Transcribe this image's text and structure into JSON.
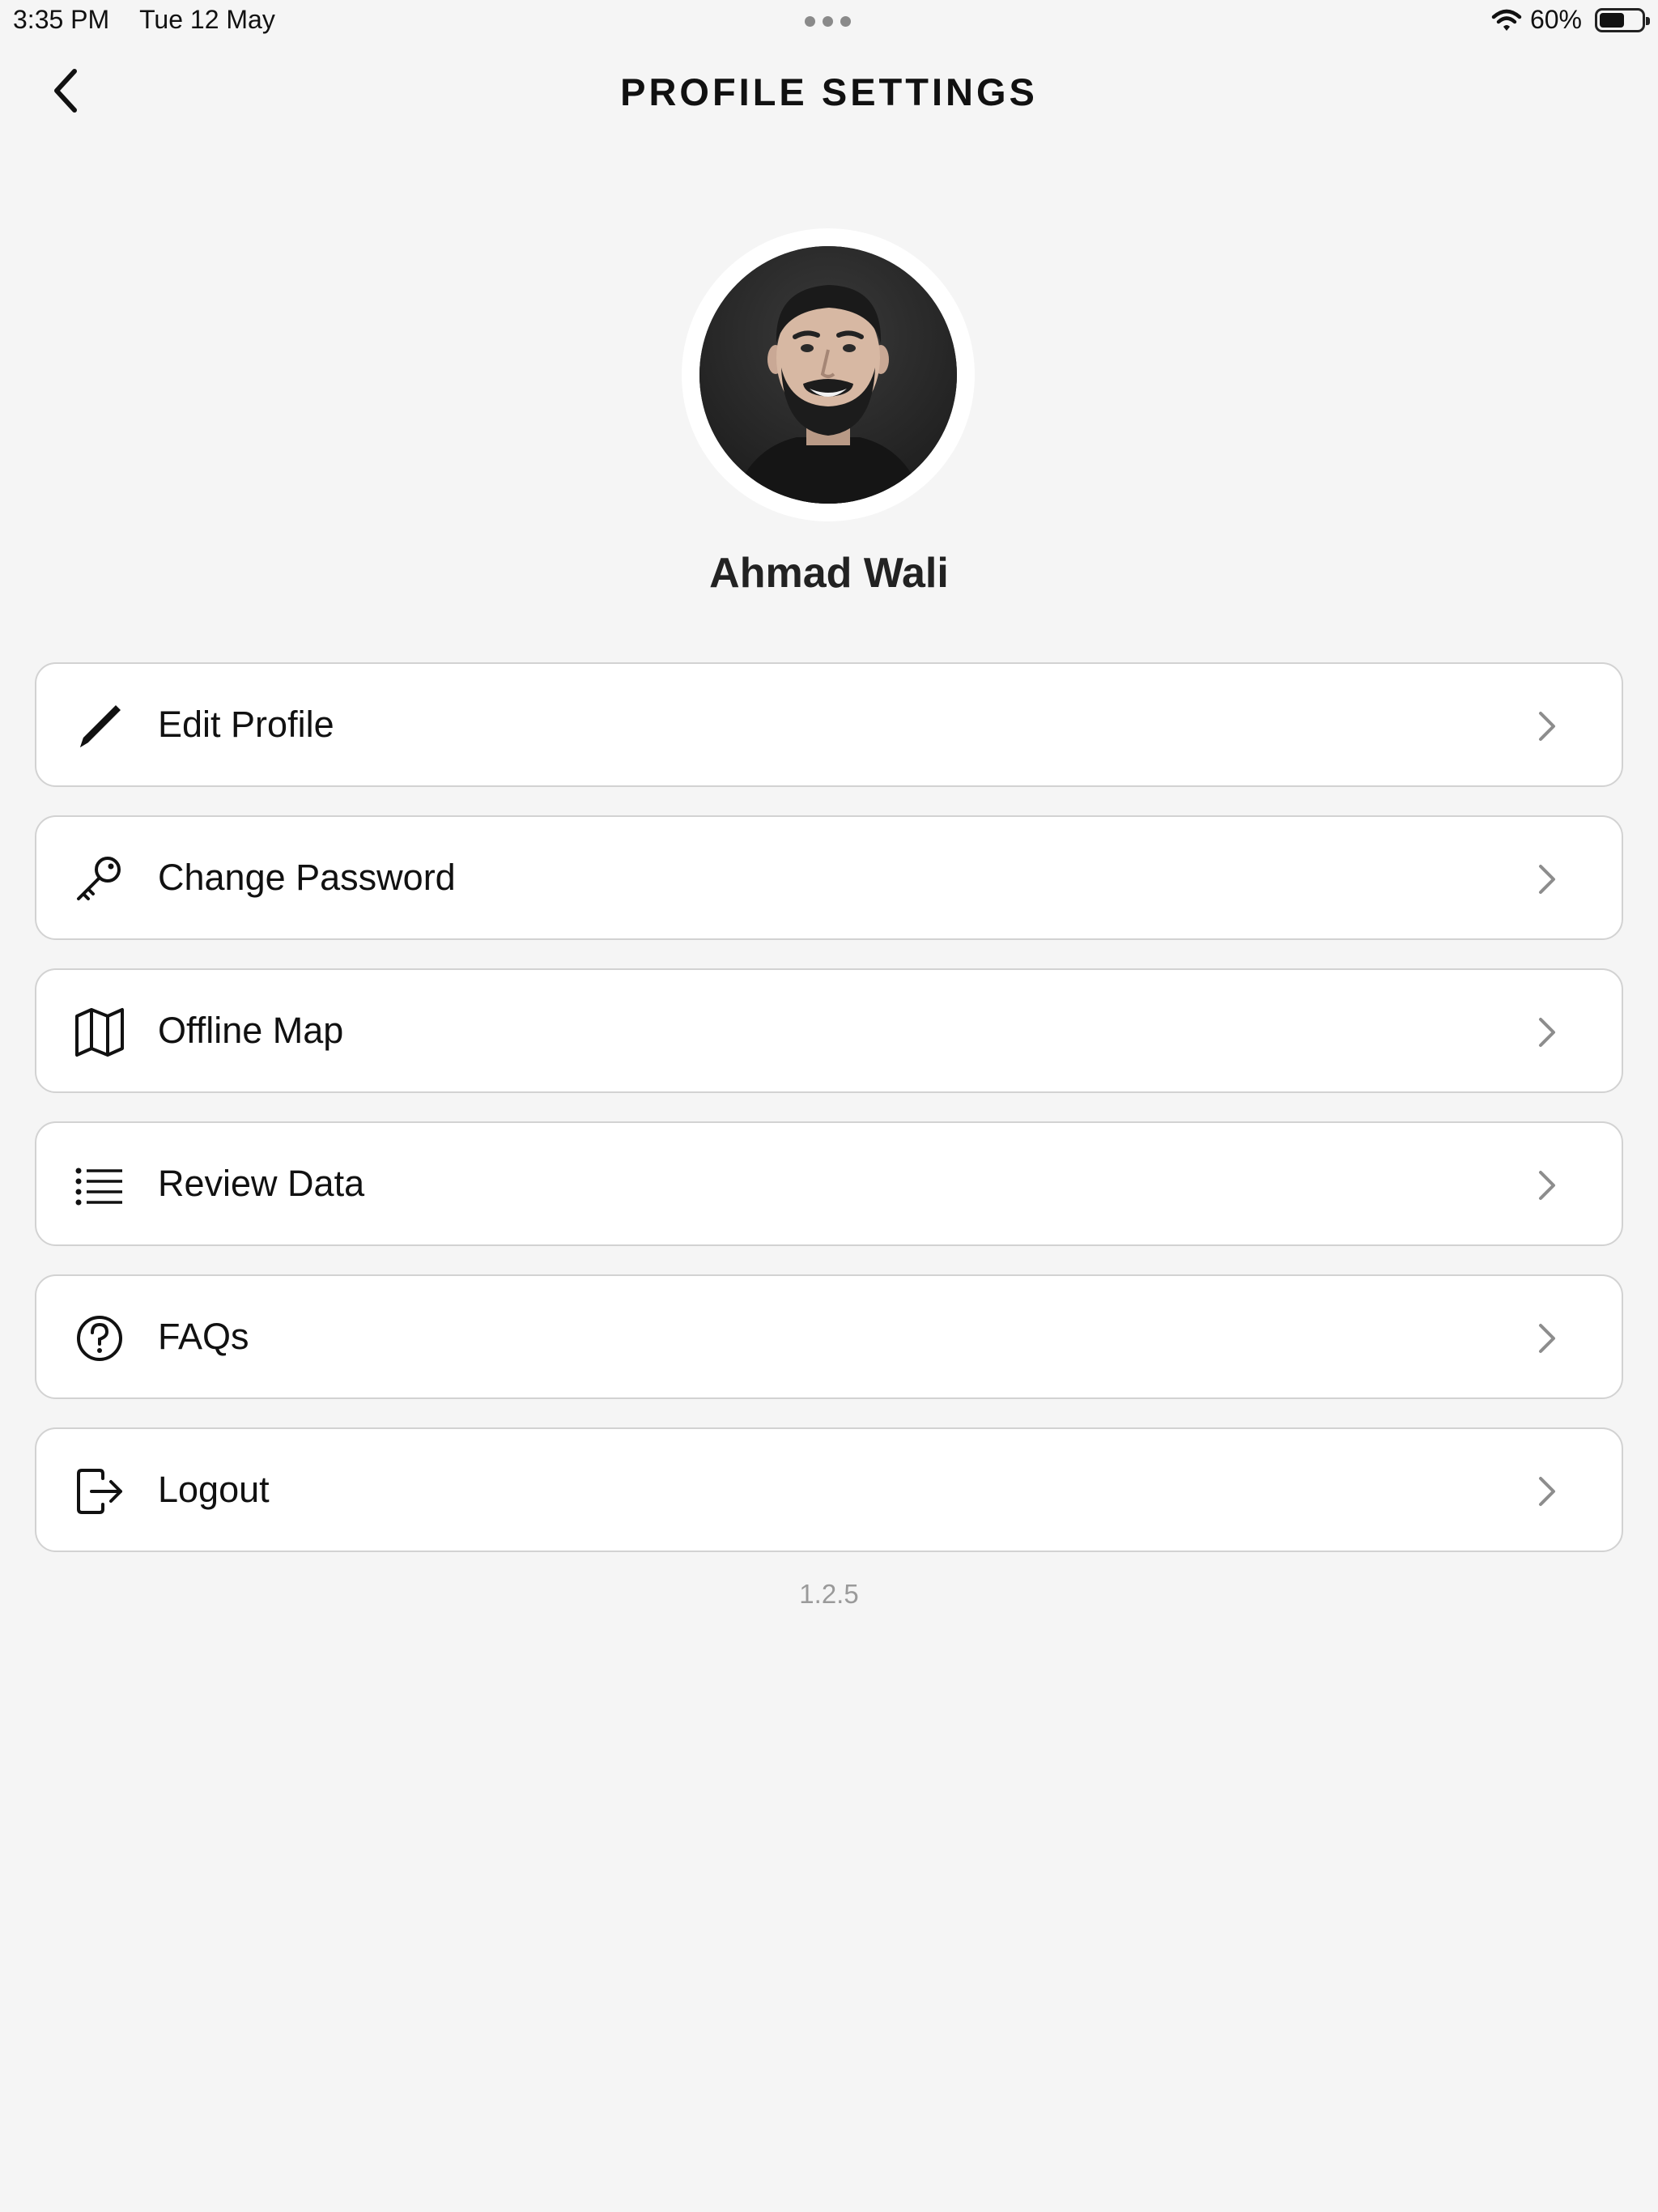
{
  "status_bar": {
    "time": "3:35 PM",
    "date": "Tue 12 May",
    "battery_percent": "60%",
    "battery_level": 0.6,
    "icons": [
      "wifi-icon",
      "battery-icon"
    ]
  },
  "header": {
    "title": "PROFILE SETTINGS",
    "back_icon": "chevron-left-icon"
  },
  "profile": {
    "name": "Ahmad Wali"
  },
  "menu": {
    "items": [
      {
        "label": "Edit Profile",
        "icon": "pencil-icon"
      },
      {
        "label": "Change Password",
        "icon": "key-icon"
      },
      {
        "label": "Offline Map",
        "icon": "map-icon"
      },
      {
        "label": "Review Data",
        "icon": "list-icon"
      },
      {
        "label": "FAQs",
        "icon": "question-circle-icon"
      },
      {
        "label": "Logout",
        "icon": "logout-icon"
      }
    ]
  },
  "footer": {
    "version": "1.2.5"
  },
  "colors": {
    "background": "#f5f5f5",
    "card": "#ffffff",
    "card_border": "#d2d2d2",
    "text": "#111111",
    "muted": "#9a9a9a"
  }
}
